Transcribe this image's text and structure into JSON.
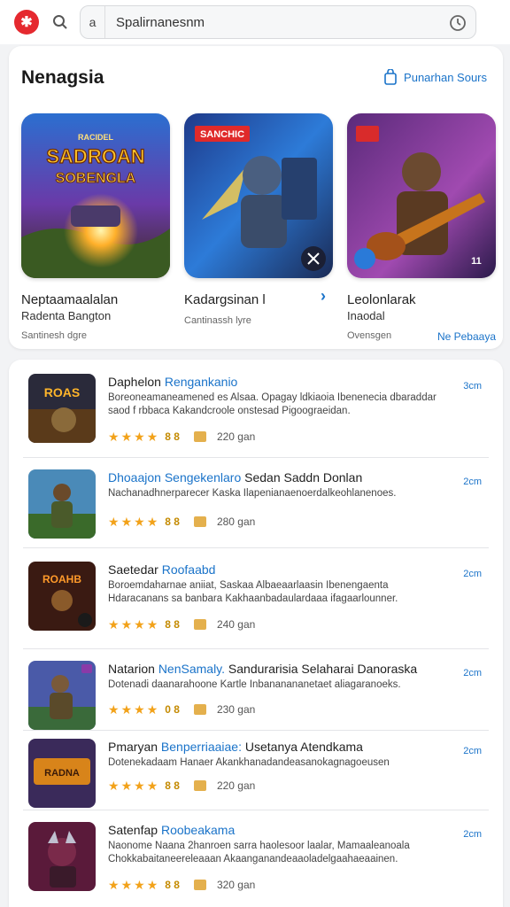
{
  "header": {
    "prefix": "a",
    "search_value": "Spalirnanesnm"
  },
  "featured": {
    "title": "Nenagsia",
    "link_label": "Punarhan Sours",
    "items": [
      {
        "name": "Neptaamaalalan",
        "sub": "Radenta Bangton",
        "meta": "Santinesh dgre",
        "more": "",
        "badge": "SADROAN SOBENGLA",
        "badge_small": "RACIDEL"
      },
      {
        "name": "Kadargsinan l",
        "sub": "",
        "meta": "Cantinassh lyre",
        "more": "",
        "badge": "SANCHIC",
        "badge_small": ""
      },
      {
        "name": "Leolonlarak",
        "sub": "Inaodal",
        "meta": "Ovensgen",
        "more": "Ne Pebaaya",
        "badge": "",
        "badge_small": ""
      }
    ]
  },
  "list": [
    {
      "title": "Daphelon",
      "accent": "Rengankanio",
      "tail": "",
      "desc": "Boreoneamaneamened es Alsaa. Opagay ldkiaoia Ibenenecia dbaraddar saod f rbbaca Kakandcroole onstesad Pigoograeidan.",
      "score": "8 8",
      "count": "220 gan",
      "size": "3cm",
      "stars": 4,
      "art": "a"
    },
    {
      "title": "",
      "accent": "Dhoaajon Sengekenlaro",
      "tail": "Sedan Saddn Donlan",
      "desc": "Nachanadhnerparecer Kaska Ilapenianaenoerdalkeohlanenoes.",
      "score": "8 8",
      "count": "280 gan",
      "size": "2cm",
      "stars": 4,
      "art": "b"
    },
    {
      "title": "Saetedar",
      "accent": "Roofaabd",
      "tail": "",
      "desc": "Boroemdaharnae aniiat, Saskaa Albaeaarlaasin Ibenengaenta Hdaracanans sa banbara Kakhaanbadaulardaaa ifagaarlounner.",
      "score": "8 8",
      "count": "240 gan",
      "size": "2cm",
      "stars": 4,
      "art": "c"
    },
    {
      "title": "Natarion",
      "accent": "NenSamaly.",
      "tail": "Sandurarisia Selaharai Danoraska",
      "desc": "Dotenadi daanarahoone Kartle Inbananananetaet aliagaranoeks.",
      "score": "0 8",
      "count": "230 gan",
      "size": "2cm",
      "stars": 4,
      "art": "d"
    },
    {
      "title": "Pmaryan",
      "accent": "Benperriaaiae:",
      "tail": "Usetanya Atendkama",
      "desc": "Dotenekadaam Hanaer Akankhanadandeasanokagnagoeusen",
      "score": "8 8",
      "count": "220 gan",
      "size": "2cm",
      "stars": 4,
      "art": "e"
    },
    {
      "title": "Satenfap",
      "accent": "Roobeakama",
      "tail": "",
      "desc": "Naonome Naana 2hanroen sarra haolesoor laalar, Mamaaleanoala Chokkabaitaneereleaaan Akaanganandeaaoladelgaahaeaainen.",
      "score": "8 8",
      "count": "320 gan",
      "size": "2cm",
      "stars": 4,
      "art": "f"
    }
  ],
  "colors": {
    "accent": "#1a73c9",
    "brand": "#e5292f",
    "star": "#f2a21a"
  }
}
